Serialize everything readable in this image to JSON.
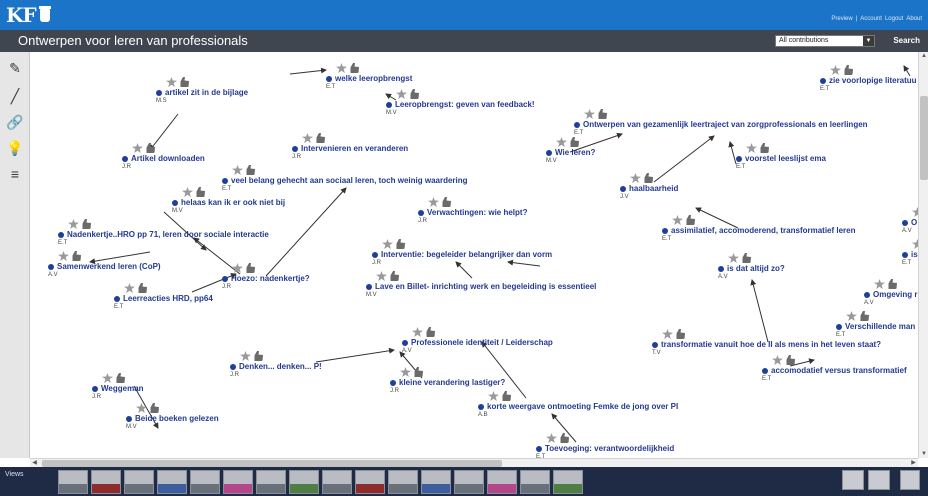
{
  "header": {
    "logo_text": "KF",
    "links": [
      "Preview",
      "|",
      "Account",
      "Logout",
      "About"
    ],
    "title": "Ontwerpen voor leren van professionals",
    "filter_value": "All contributions",
    "search_label": "Search"
  },
  "toolbar": {
    "tools": [
      {
        "name": "pencil-tool",
        "icon": "pencil-icon",
        "glyph": "✎"
      },
      {
        "name": "pen-tool",
        "icon": "pen-icon",
        "glyph": "╱"
      },
      {
        "name": "link-tool",
        "icon": "link-icon",
        "glyph": "🔗"
      },
      {
        "name": "bulb-tool",
        "icon": "lightbulb-icon",
        "glyph": "💡"
      },
      {
        "name": "list-tool",
        "icon": "list-icon",
        "glyph": "≡"
      }
    ]
  },
  "notes": [
    {
      "id": "n1",
      "title": "welke leeropbrengst",
      "author": "E.T"
    },
    {
      "id": "n2",
      "title": "Leeropbrengst: geven van feedback!",
      "author": "M.V"
    },
    {
      "id": "n3",
      "title": "artikel zit in de bijlage",
      "author": "M.S"
    },
    {
      "id": "n4",
      "title": "Artikel downloaden",
      "author": "J.R"
    },
    {
      "id": "n5",
      "title": "Intervenieren en veranderen",
      "author": "J.R"
    },
    {
      "id": "n6",
      "title": "veel belang gehecht aan sociaal leren, toch weinig waardering",
      "author": "E.T"
    },
    {
      "id": "n7",
      "title": "helaas kan ik er ook niet bij",
      "author": "M.V"
    },
    {
      "id": "n8",
      "title": "Verwachtingen: wie helpt?",
      "author": "J.R"
    },
    {
      "id": "n9",
      "title": "Nadenkertje..HRO pp 71, leren door sociale interactie",
      "author": "E.T"
    },
    {
      "id": "n10",
      "title": "Samenwerkend leren (CoP)",
      "author": "A.V"
    },
    {
      "id": "n11",
      "title": "Leerreacties HRD, pp64",
      "author": "E.T"
    },
    {
      "id": "n12",
      "title": "Hoezo: nadenkertje?",
      "author": "J.R"
    },
    {
      "id": "n13",
      "title": "Interventie: begeleider belangrijker dan vorm",
      "author": "J.R"
    },
    {
      "id": "n14",
      "title": "Lave en Billet- inrichting werk en begeleiding is essentieel",
      "author": "M.V"
    },
    {
      "id": "n15",
      "title": "Ontwerpen van gezamenlijk leertraject van zorgprofessionals en leerlingen",
      "author": "E.T"
    },
    {
      "id": "n16",
      "title": "Wie leren?",
      "author": "M.V"
    },
    {
      "id": "n17",
      "title": "voorstel leeslijst ema",
      "author": "E.T"
    },
    {
      "id": "n18",
      "title": "haalbaarheid",
      "author": "J.V"
    },
    {
      "id": "n19",
      "title": "assimilatief, accomoderend, transformatief leren",
      "author": "E.T"
    },
    {
      "id": "n20",
      "title": "is dat altijd zo?",
      "author": "A.V"
    },
    {
      "id": "n21",
      "title": "zie voorlopige literatuu",
      "author": "E.T"
    },
    {
      "id": "n22",
      "title": "Omgeving r",
      "author": "A.V"
    },
    {
      "id": "n23",
      "title": "Verschillende man",
      "author": "E.T"
    },
    {
      "id": "n24",
      "title": "transformatie vanuit hoe de II als mens in het leven staat?",
      "author": "T.V"
    },
    {
      "id": "n25",
      "title": "accomodatief versus transformatief",
      "author": "E.T"
    },
    {
      "id": "n26",
      "title": "Professionele identiteit / Leiderschap",
      "author": "A.V"
    },
    {
      "id": "n27",
      "title": "Denken... denken... P!",
      "author": "J.R"
    },
    {
      "id": "n28",
      "title": "kleine verandering lastiger?",
      "author": "J.R"
    },
    {
      "id": "n29",
      "title": "korte weergave ontmoeting Femke de jong over PI",
      "author": "A.B"
    },
    {
      "id": "n30",
      "title": "Weggeman",
      "author": "J.R"
    },
    {
      "id": "n31",
      "title": "Beide boeken gelezen",
      "author": "M.V"
    },
    {
      "id": "n32",
      "title": "Toevoeging: verantwoordelijkheid",
      "author": "E.T"
    },
    {
      "id": "n33",
      "title": "O",
      "author": "A.V"
    },
    {
      "id": "n34",
      "title": "is",
      "author": "E.T"
    }
  ],
  "views": {
    "label": "Views"
  }
}
